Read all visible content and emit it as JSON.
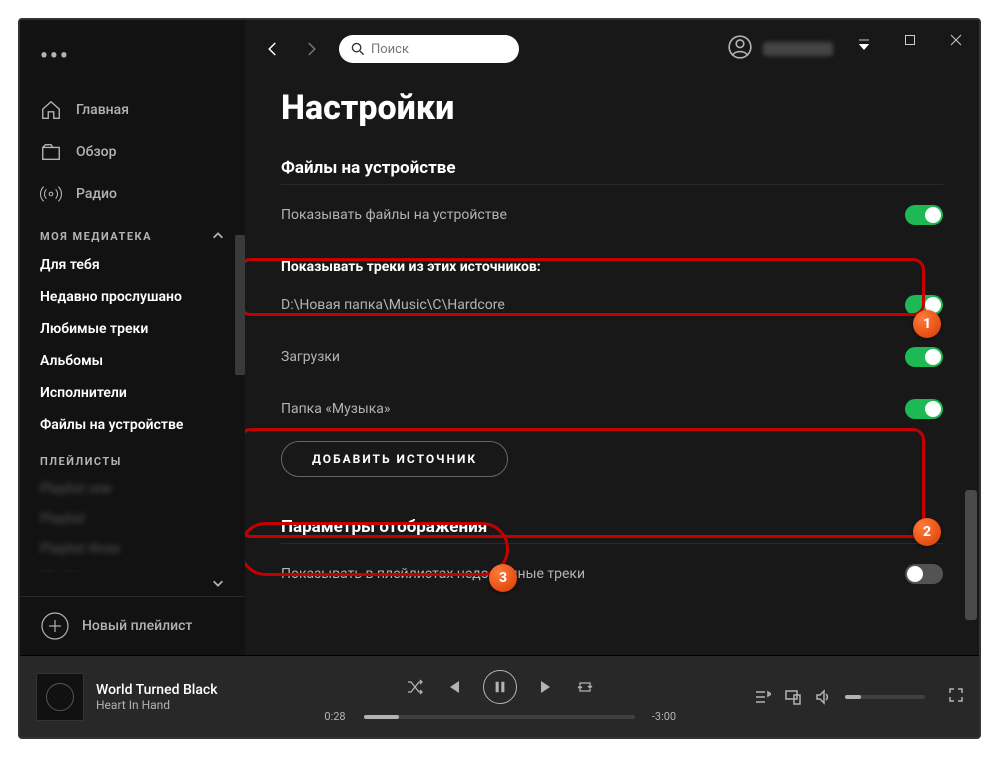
{
  "sidebar": {
    "nav": {
      "home": "Главная",
      "browse": "Обзор",
      "radio": "Радио"
    },
    "library_header": "МОЯ МЕДИАТЕКА",
    "library": [
      "Для тебя",
      "Недавно прослушано",
      "Любимые треки",
      "Альбомы",
      "Исполнители",
      "Файлы на устройстве"
    ],
    "playlists_header": "ПЛЕЙЛИСТЫ",
    "playlists": [
      "Playlist one",
      "Playlist",
      "Playlist three",
      "Playlist"
    ],
    "new_playlist": "Новый плейлист"
  },
  "topbar": {
    "search_placeholder": "Поиск"
  },
  "settings": {
    "title": "Настройки",
    "local_files_header": "Файлы на устройстве",
    "show_local_files": "Показывать файлы на устройстве",
    "show_tracks_from": "Показывать треки из этих источников:",
    "sources": [
      {
        "path": "D:\\Новая папка\\Music\\C\\Hardcore",
        "on": true
      },
      {
        "path": "Загрузки",
        "on": true
      },
      {
        "path": "Папка «Музыка»",
        "on": true
      }
    ],
    "add_source_btn": "ДОБАВИТЬ ИСТОЧНИК",
    "display_header": "Параметры отображения",
    "show_unavailable": "Показывать в плейлистах недоступные треки"
  },
  "annotations": {
    "b1": "1",
    "b2": "2",
    "b3": "3"
  },
  "player": {
    "track": "World Turned Black",
    "artist": "Heart In Hand",
    "elapsed": "0:28",
    "remaining": "-3:00"
  }
}
